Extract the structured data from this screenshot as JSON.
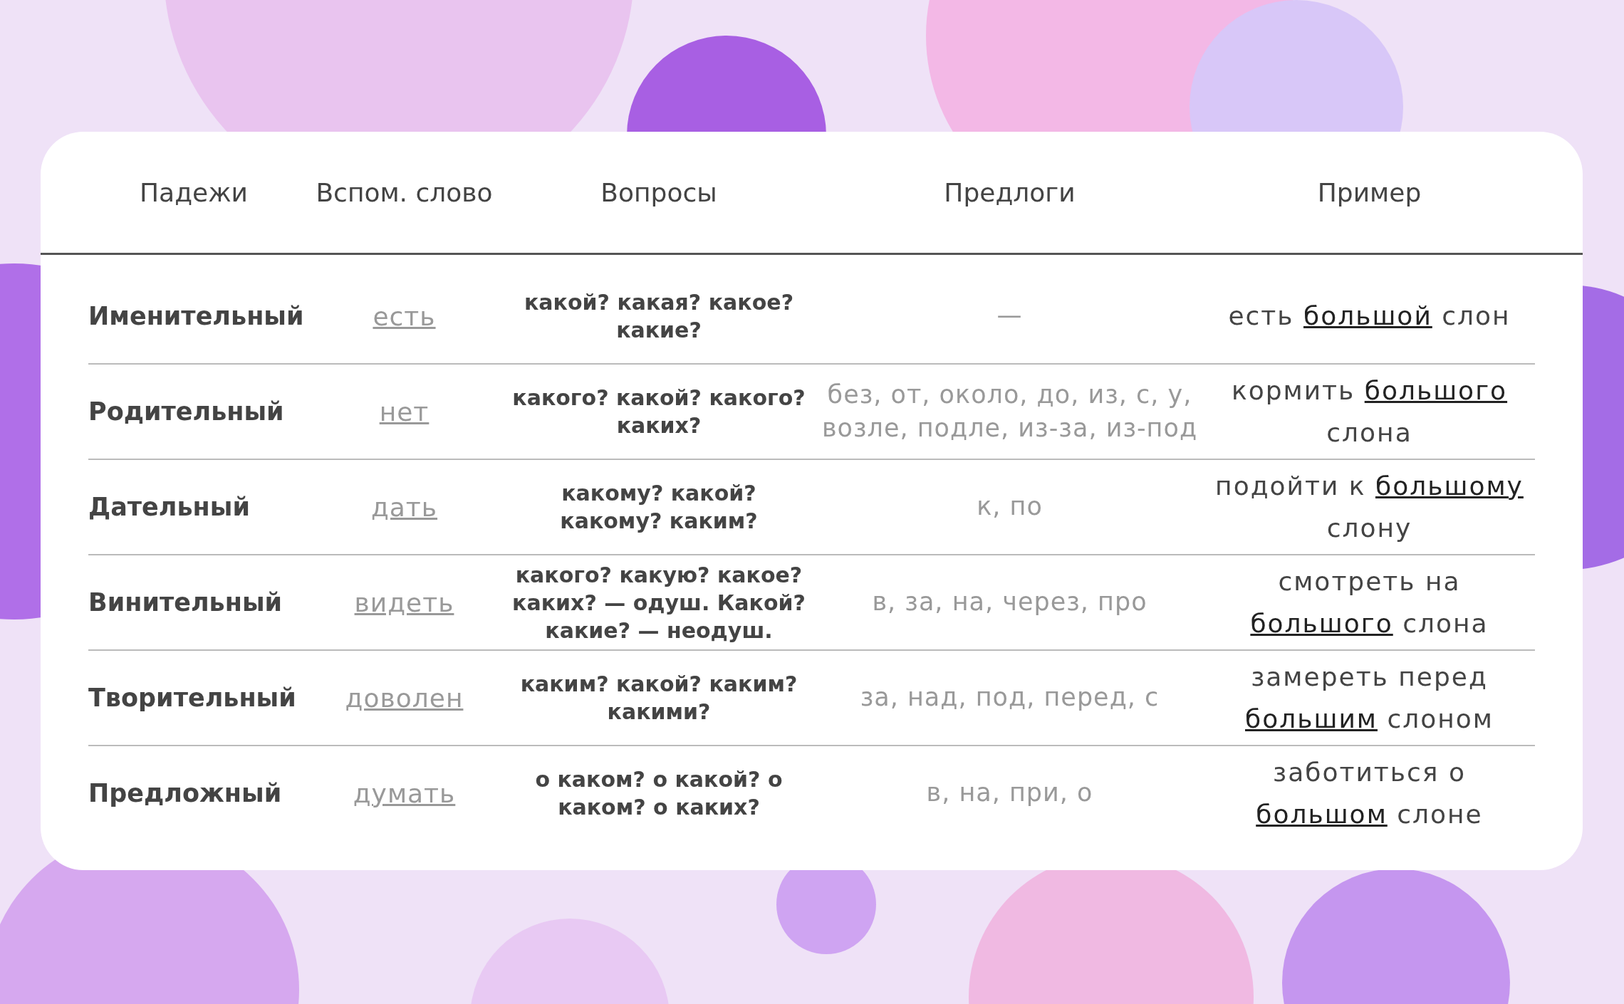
{
  "table": {
    "columns": [
      "Падежи",
      "Вспом. слово",
      "Вопросы",
      "Предлоги",
      "Пример"
    ],
    "rows": [
      {
        "case": "Именительный",
        "helper_word": "есть",
        "questions": "какой? какая? какое? какие?",
        "prepositions": "—",
        "example": "есть **большой** слон"
      },
      {
        "case": "Родительный",
        "helper_word": "нет",
        "questions": "какого? какой? какого? каких?",
        "prepositions": "без, от, около, до, из, с, у, возле, подле, из-за, из-под",
        "example": "кормить **большого** слона"
      },
      {
        "case": "Дательный",
        "helper_word": "дать",
        "questions": "какому? какой? какому? каким?",
        "prepositions": "к, по",
        "example": "подойти к **большому** слону"
      },
      {
        "case": "Винительный",
        "helper_word": "видеть",
        "questions": "какого? какую? какое? каких? — одуш. Какой? какие? — неодуш.",
        "prepositions": "в, за, на, через, про",
        "example": "смотреть на **большого** слона"
      },
      {
        "case": "Творительный",
        "helper_word": "доволен",
        "questions": "каким? какой? каким? какими?",
        "prepositions": "за, над, под, перед, с",
        "example": "замереть перед **большим** слоном"
      },
      {
        "case": "Предложный",
        "helper_word": "думать",
        "questions": "о каком? о какой? о каком? о каких?",
        "prepositions": "в, на, при, о",
        "example": "заботиться о **большом** слоне"
      }
    ]
  }
}
